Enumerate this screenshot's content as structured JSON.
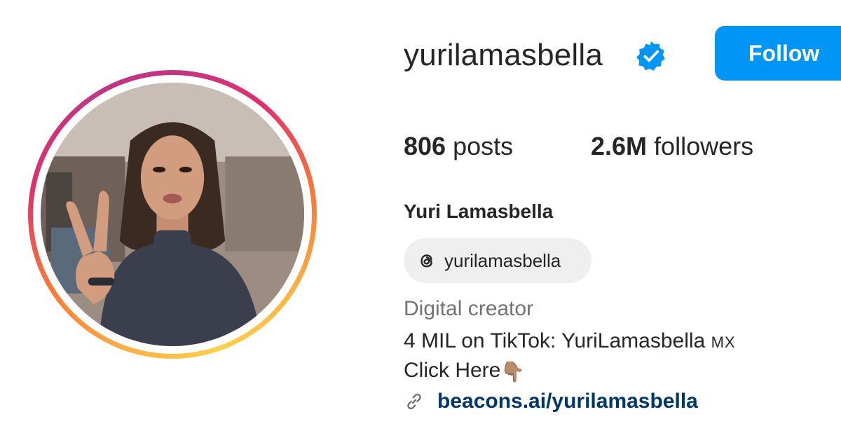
{
  "profile": {
    "username": "yurilamasbella",
    "verified_icon": "verified-badge-icon",
    "follow_label": "Follow",
    "posts_count": "806",
    "posts_label": " posts",
    "followers_count": "2.6M",
    "followers_label": " followers",
    "full_name": "Yuri Lamasbella",
    "threads_handle": "yurilamasbella",
    "category": "Digital creator",
    "bio_line1_main": "4 MIL on TikTok: YuriLamasbella ",
    "bio_line1_small": "MX",
    "bio_line2": "Click Here",
    "bio_line2_emoji": "👇🏽",
    "link": "beacons.ai/yurilamasbella"
  },
  "colors": {
    "accent": "#0095f6",
    "link": "#00376b",
    "muted": "#737373",
    "text": "#262626",
    "pill_bg": "#efefef"
  }
}
